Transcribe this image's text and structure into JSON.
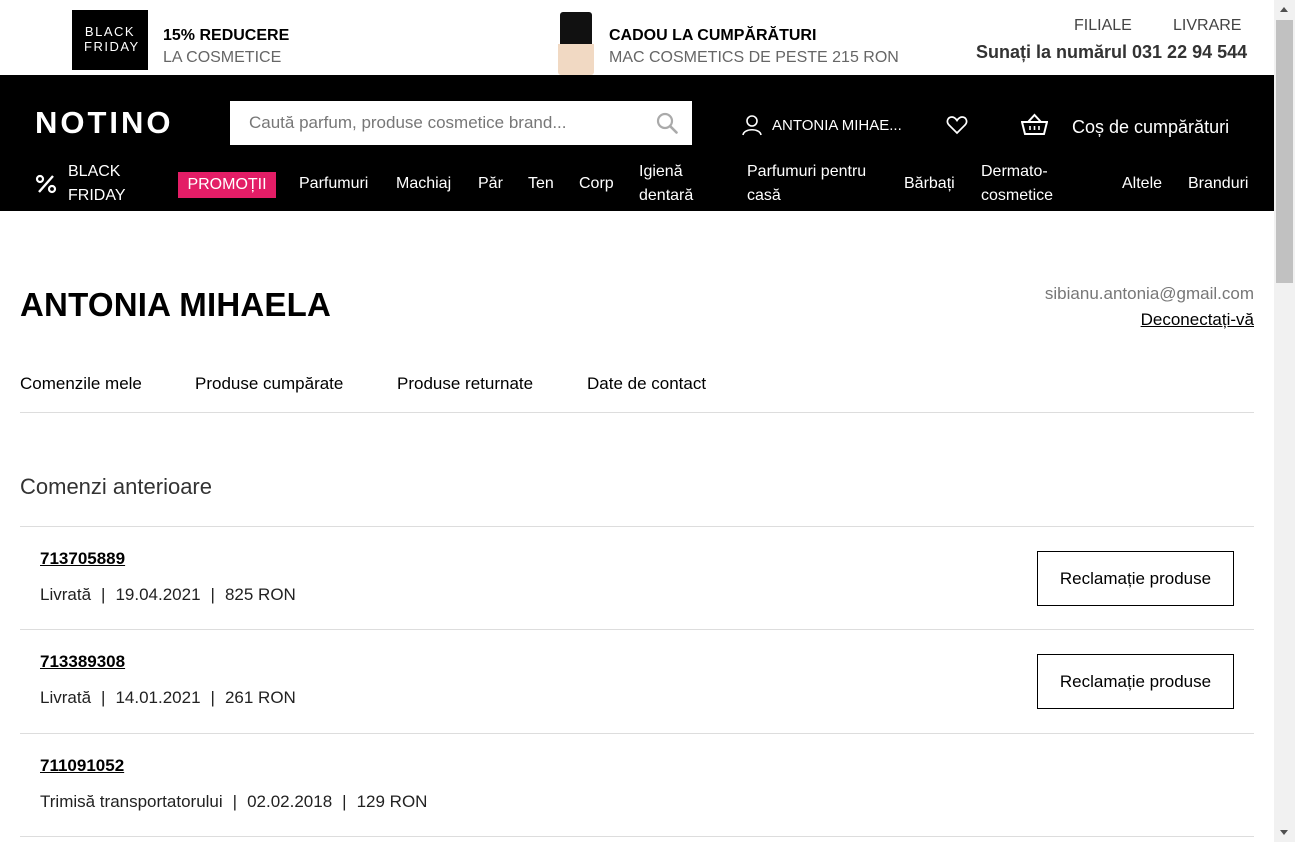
{
  "promo": {
    "black_friday_badge": "BLACK FRIDAY",
    "offer1_title": "15% REDUCERE",
    "offer1_subtitle": "LA COSMETICE",
    "offer2_title": "CADOU LA CUMPĂRĂTURI",
    "offer2_subtitle": "MAC COSMETICS DE PESTE 215 RON",
    "filiale": "FILIALE",
    "livrare": "LIVRARE",
    "phone": "Sunați la numărul 031 22 94 544"
  },
  "header": {
    "logo": "NOTINO",
    "search_placeholder": "Caută parfum, produse cosmetice brand...",
    "user_name": "ANTONIA MIHAE...",
    "cart_label": "Coș de cumpărături"
  },
  "nav": {
    "black_friday_1": "BLACK",
    "black_friday_2": "FRIDAY",
    "promotii": "PROMOȚII",
    "parfumuri": "Parfumuri",
    "machiaj": "Machiaj",
    "par": "Păr",
    "ten": "Ten",
    "corp": "Corp",
    "igiena_1": "Igienă",
    "igiena_2": "dentară",
    "casa_1": "Parfumuri pentru",
    "casa_2": "casă",
    "barbati": "Bărbați",
    "dermato_1": "Dermato-",
    "dermato_2": "cosmetice",
    "altele": "Altele",
    "branduri": "Branduri"
  },
  "account": {
    "name": "ANTONIA MIHAELA",
    "email": "sibianu.antonia@gmail.com",
    "logout": "Deconectați-vă",
    "tabs": [
      "Comenzile mele",
      "Produse cumpărate",
      "Produse returnate",
      "Date de contact"
    ]
  },
  "orders": {
    "section_title": "Comenzi anterioare",
    "claim_label": "Reclamație produse",
    "separator": "|",
    "items": [
      {
        "number": "713705889",
        "status": "Livrată",
        "date": "19.04.2021",
        "amount": "825 RON"
      },
      {
        "number": "713389308",
        "status": "Livrată",
        "date": "14.01.2021",
        "amount": "261 RON"
      },
      {
        "number": "711091052",
        "status": "Trimisă transportatorului",
        "date": "02.02.2018",
        "amount": "129 RON"
      }
    ]
  },
  "colors": {
    "accent": "#e31d66",
    "header_bg": "#000000"
  },
  "icons": [
    "search-icon",
    "user-icon",
    "heart-icon",
    "basket-icon",
    "percent-icon"
  ]
}
